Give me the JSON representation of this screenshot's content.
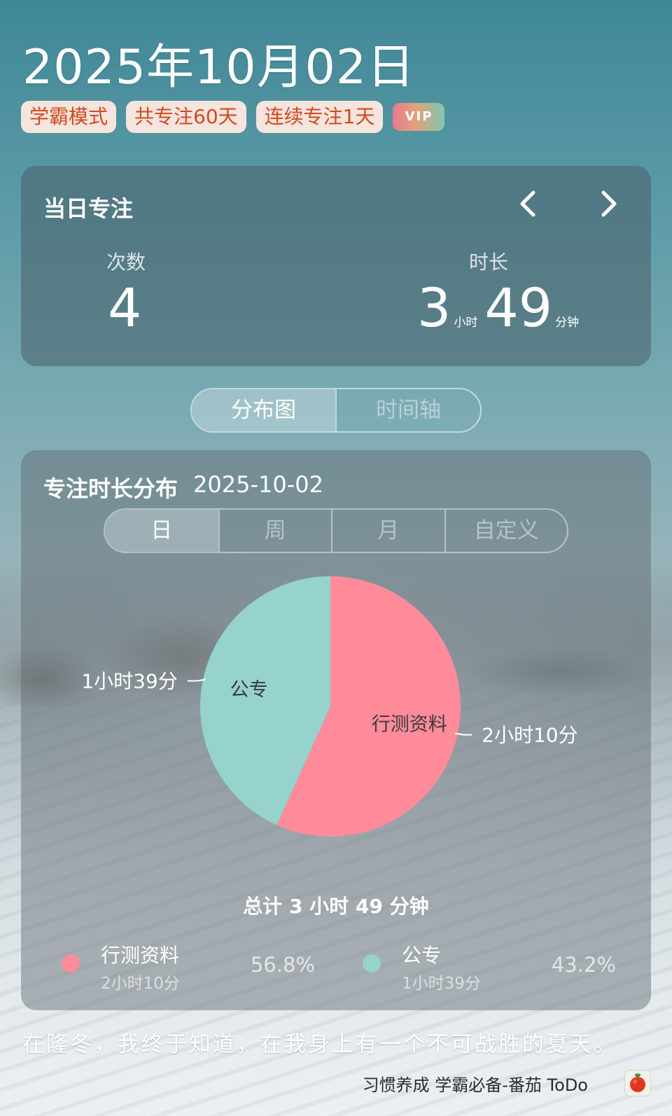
{
  "date_title": "2025年10月02日",
  "badges": {
    "mode": "学霸模式",
    "total_days": "共专注60天",
    "streak": "连续专注1天",
    "vip": "VIP"
  },
  "summary": {
    "title": "当日专注",
    "count_label": "次数",
    "count_value": "4",
    "duration_label": "时长",
    "hours": "3",
    "hours_unit": "小时",
    "minutes": "49",
    "minutes_unit": "分钟",
    "prev_icon": "chevron-left-icon",
    "next_icon": "chevron-right-icon"
  },
  "view_tabs": [
    {
      "label": "分布图",
      "active": true
    },
    {
      "label": "时间轴",
      "active": false
    }
  ],
  "distribution": {
    "title": "专注时长分布",
    "date": "2025-10-02",
    "range_tabs": [
      {
        "label": "日",
        "active": true
      },
      {
        "label": "周",
        "active": false
      },
      {
        "label": "月",
        "active": false
      },
      {
        "label": "自定义",
        "active": false
      }
    ],
    "total_text": "总计 3 小时 49 分钟"
  },
  "chart_data": {
    "type": "pie",
    "slices": [
      {
        "name": "行测资料",
        "value_minutes": 130,
        "value_label": "2小时10分",
        "percent": "56.8%",
        "color": "#ff8b9b"
      },
      {
        "name": "公专",
        "value_minutes": 99,
        "value_label": "1小时39分",
        "percent": "43.2%",
        "color": "#95d3cc"
      }
    ]
  },
  "quote": "在隆冬，我终于知道，在我身上有一个不可战胜的夏天。",
  "footer": {
    "text": "习惯养成 学霸必备-番茄 ToDo",
    "logo_icon": "tomato-icon"
  }
}
